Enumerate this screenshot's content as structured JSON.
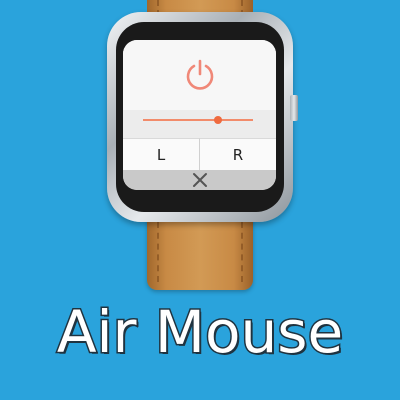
{
  "app": {
    "title": "Air Mouse"
  },
  "controls": {
    "power_icon": "power-icon",
    "left_button_label": "L",
    "right_button_label": "R",
    "close_icon": "close-icon"
  },
  "slider": {
    "level_fraction": 0.68
  },
  "colors": {
    "background": "#2aa3dc",
    "power_icon": "#f08878",
    "slider_accent": "#ef6a3e",
    "title_fill": "#ffffff",
    "title_outline": "#1f3340"
  }
}
